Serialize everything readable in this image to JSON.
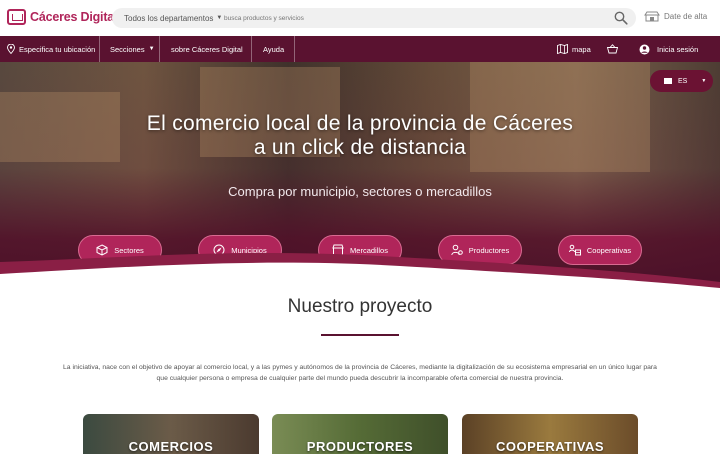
{
  "header": {
    "logo_text": "Cáceres Digital",
    "departments_label": "Todos los departamentos",
    "search_placeholder": "busca productos y servicios",
    "signup_label": "Date de alta"
  },
  "nav": {
    "location_label": "Especifica tu ubicación",
    "sections_label": "Secciones",
    "about_label": "sobre Cáceres Digital",
    "help_label": "Ayuda",
    "map_label": "mapa",
    "login_label": "Inicia sesión"
  },
  "hero": {
    "title_line1": "El comercio local de la provincia de Cáceres",
    "title_line2": "a un click de distancia",
    "subtitle": "Compra por municipio, sectores o mercadillos",
    "language": "ES",
    "pills": [
      {
        "label": "Sectores",
        "icon": "box-icon"
      },
      {
        "label": "Municipios",
        "icon": "compass-icon"
      },
      {
        "label": "Mercadillos",
        "icon": "market-stall-icon"
      },
      {
        "label": "Productores",
        "icon": "producer-icon"
      },
      {
        "label": "Cooperativas",
        "icon": "cooperative-icon"
      }
    ]
  },
  "project": {
    "title": "Nuestro proyecto",
    "text": "La iniciativa, nace con el objetivo de apoyar al comercio local, y a las pymes y autónomos de la provincia de Cáceres, mediante la digitalización de su ecosistema empresarial en un único lugar para que cualquier persona o empresa de cualquier parte del mundo pueda descubrir la incomparable oferta comercial de nuestra provincia."
  },
  "cards": [
    {
      "label": "COMERCIOS"
    },
    {
      "label": "PRODUCTORES"
    },
    {
      "label": "COOPERATIVAS"
    }
  ],
  "colors": {
    "brand": "#b0255a",
    "navbar": "#5a1230",
    "pill": "#b0255a"
  }
}
